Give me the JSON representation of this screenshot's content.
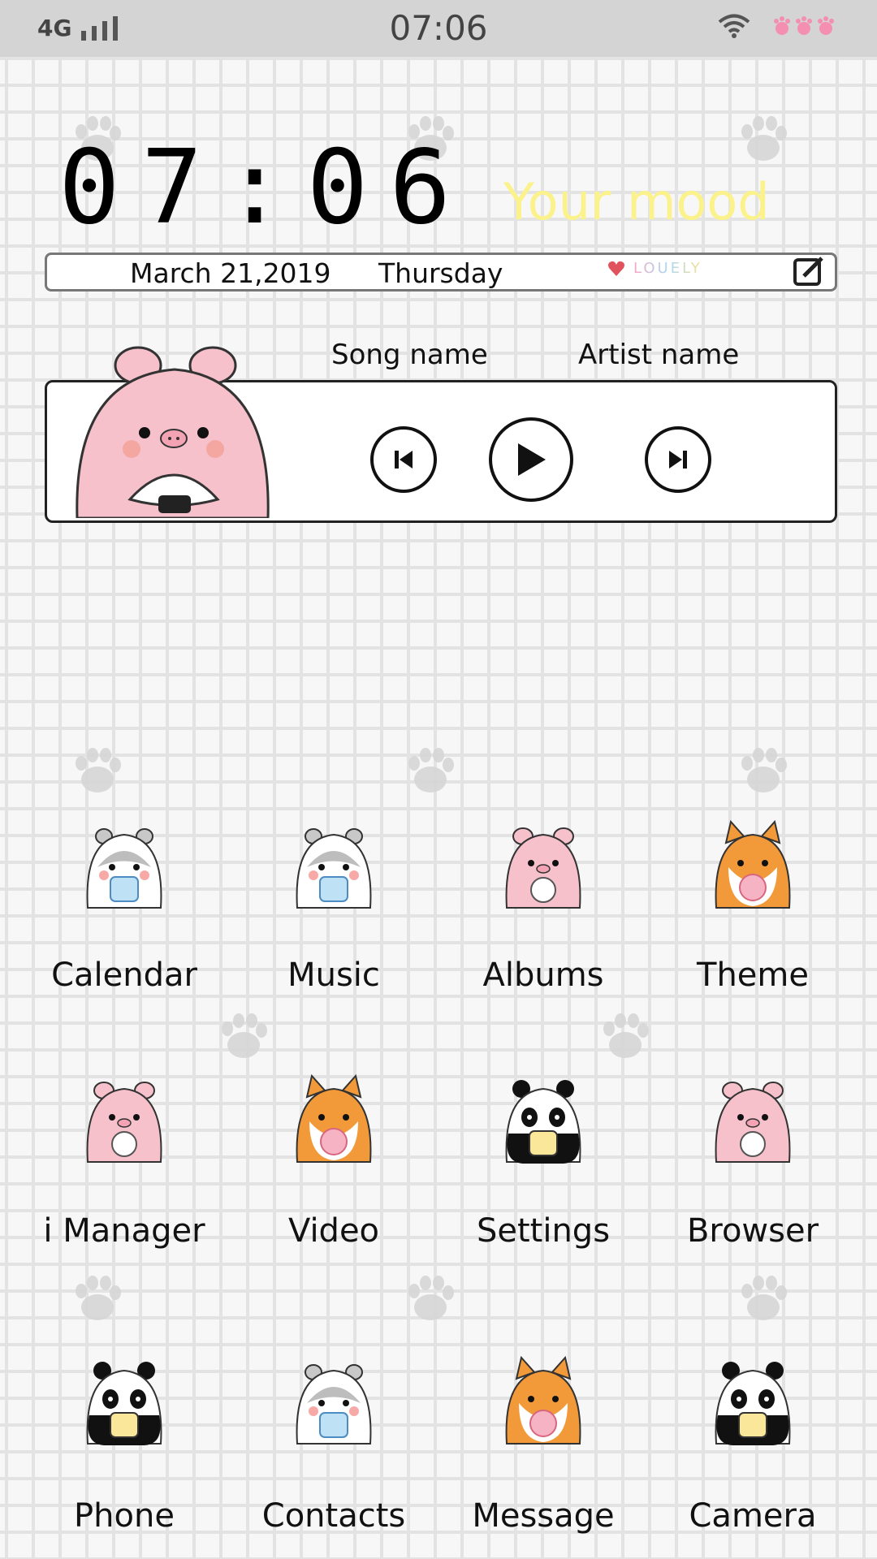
{
  "status_bar": {
    "network": "4G",
    "time": "07:06",
    "icons": [
      "signal-icon",
      "wifi-icon",
      "paw-battery-icon"
    ]
  },
  "widget": {
    "clock": "07:06",
    "mood": "Your mood",
    "date": "March 21,2019",
    "weekday": "Thursday",
    "lovely_sticker": "LOUELY"
  },
  "music": {
    "song": "Song name",
    "artist": "Artist name",
    "controls": [
      "previous-icon",
      "play-icon",
      "next-icon"
    ]
  },
  "apps": [
    {
      "label": "Calendar",
      "icon": "hamster-calendar-icon"
    },
    {
      "label": "Music",
      "icon": "hamster-music-icon"
    },
    {
      "label": "Albums",
      "icon": "pig-albums-icon"
    },
    {
      "label": "Theme",
      "icon": "shiba-theme-icon"
    },
    {
      "label": "i Manager",
      "icon": "pig-manager-icon"
    },
    {
      "label": "Video",
      "icon": "shiba-video-icon"
    },
    {
      "label": "Settings",
      "icon": "panda-settings-icon"
    },
    {
      "label": "Browser",
      "icon": "pig-browser-icon"
    },
    {
      "label": "Phone",
      "icon": "panda-phone-icon"
    },
    {
      "label": "Contacts",
      "icon": "hamster-contacts-icon"
    },
    {
      "label": "Message",
      "icon": "shiba-message-icon"
    },
    {
      "label": "Camera",
      "icon": "panda-camera-icon"
    }
  ],
  "colors": {
    "mood_text": "#fbf28c",
    "status_bar_bg": "#d4d4d4",
    "pig_pink": "#f6c1cb",
    "shiba_orange": "#f29a3a"
  }
}
